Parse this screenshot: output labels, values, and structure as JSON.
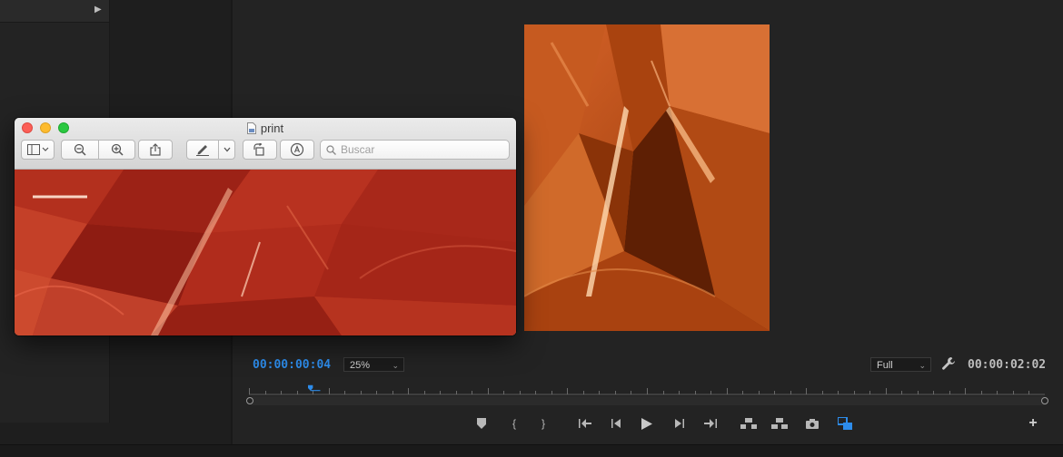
{
  "preview_window": {
    "title": "print",
    "search": {
      "placeholder": "Buscar"
    }
  },
  "monitor": {
    "current_timecode": "00:00:00:04",
    "duration_timecode": "00:00:02:02",
    "zoom_select": {
      "value": "25%"
    },
    "resolution_select": {
      "value": "Full"
    },
    "playhead_fraction": 0.08
  },
  "colors": {
    "timecode_accent": "#2d8ceb",
    "foil_orange": "#c8561c",
    "foil_red": "#b8301c"
  },
  "icons": {
    "transport": [
      "marker-icon",
      "mark-in-icon",
      "mark-out-icon",
      "go-to-in-icon",
      "step-back-icon",
      "play-icon",
      "step-forward-icon",
      "go-to-out-icon",
      "lift-icon",
      "extract-icon",
      "export-frame-icon",
      "comparison-view-icon"
    ]
  }
}
